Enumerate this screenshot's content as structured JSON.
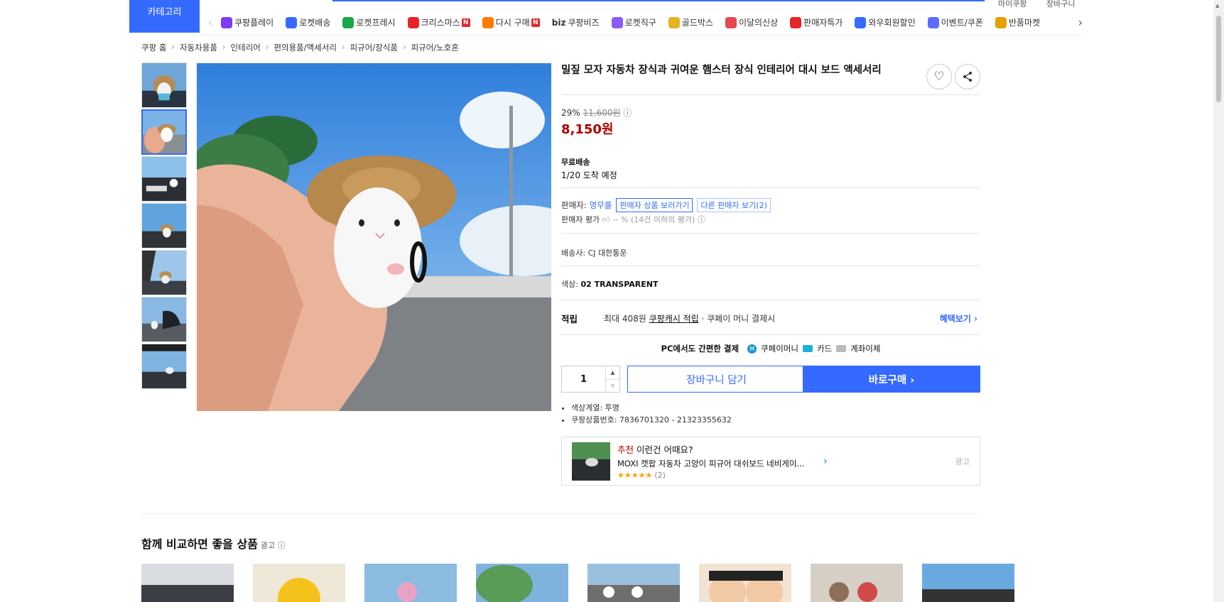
{
  "header": {
    "category_label": "카테고리",
    "top_links": [
      "마이쿠팡",
      "장바구니"
    ]
  },
  "nav": {
    "items": [
      {
        "label": "쿠팡플레이",
        "icon": "play-icon",
        "color": "#7e3cf5"
      },
      {
        "label": "로켓배송",
        "icon": "rocket-icon",
        "color": "#346aff"
      },
      {
        "label": "로켓프레시",
        "icon": "rocket-fresh-icon",
        "color": "#19a74a"
      },
      {
        "label": "크리스마스",
        "icon": "santa-icon",
        "color": "#e52528",
        "badge": "N"
      },
      {
        "label": "다시 구매",
        "icon": "basket-icon",
        "color": "#ff7a00",
        "badge": "N"
      },
      {
        "label": "쿠팡비즈",
        "icon": "biz-icon",
        "color": "#333333",
        "prefix": "biz"
      },
      {
        "label": "로켓직구",
        "icon": "globe-icon",
        "color": "#8b5cf6"
      },
      {
        "label": "골드박스",
        "icon": "gold-box-icon",
        "color": "#e6b422"
      },
      {
        "label": "이달의신상",
        "icon": "new-bag-icon",
        "color": "#e5484d"
      },
      {
        "label": "판매자특가",
        "icon": "percent-icon",
        "color": "#e52528"
      },
      {
        "label": "와우회원할인",
        "icon": "wow-icon",
        "color": "#346aff"
      },
      {
        "label": "이벤트/쿠폰",
        "icon": "coupon-icon",
        "color": "#5b6cff"
      },
      {
        "label": "반품마켓",
        "icon": "return-market-icon",
        "color": "#e6a100"
      }
    ]
  },
  "breadcrumb": [
    "쿠팡 홈",
    "자동차용품",
    "인테리어",
    "편의용품/액세서리",
    "피규어/장식품",
    "피규어/노호혼"
  ],
  "product": {
    "title": "밀짚 모자 자동차 장식과 귀여운 햄스터 장식 인테리어 대시 보드 액세서리",
    "discount": "29%",
    "original_price": "11,600원",
    "price": "8,150원",
    "shipping_label": "무료배송",
    "arrival": "1/20 도착 예정",
    "seller_label": "판매자:",
    "seller_name": "영무롤",
    "seller_products_btn": "판매자 상품 보러가기",
    "other_sellers_btn": "다른 판매자 보기(2)",
    "seller_rating_label": "판매자 평가",
    "seller_rating_value": "-- % (14건 이하의 평가)",
    "carrier_label": "배송사:",
    "carrier": "CJ 대한통운",
    "color_label": "색상:",
    "color_value": "02 TRANSPARENT",
    "reward_label": "적립",
    "reward_prefix": "최대 408원",
    "reward_link": "쿠팡캐시 적립",
    "reward_suffix": "· 쿠페이 머니 결제시",
    "benefit_link": "혜택보기 ›",
    "pay_title": "PC에서도 간편한 결제",
    "pay_methods": [
      "쿠페이머니",
      "카드",
      "계좌이체"
    ],
    "quantity": "1",
    "cart_btn": "장바구니 담기",
    "buy_btn": "바로구매 ›",
    "bullets": [
      "색상계열: 투명",
      "쿠팡상품번호: 7836701320 - 21323355632"
    ]
  },
  "recommend": {
    "tag": "추천",
    "headline": " 이런건 어때요?",
    "name": "MOXI 캣팝 자동차 고양이 피규어 대쉬보드 네비게이...",
    "stars": "★★★★★",
    "count": "(2)",
    "ad": "광고"
  },
  "compare": {
    "title": "함께 비교하면 좋을 상품",
    "ad": "광고 ⓘ"
  }
}
